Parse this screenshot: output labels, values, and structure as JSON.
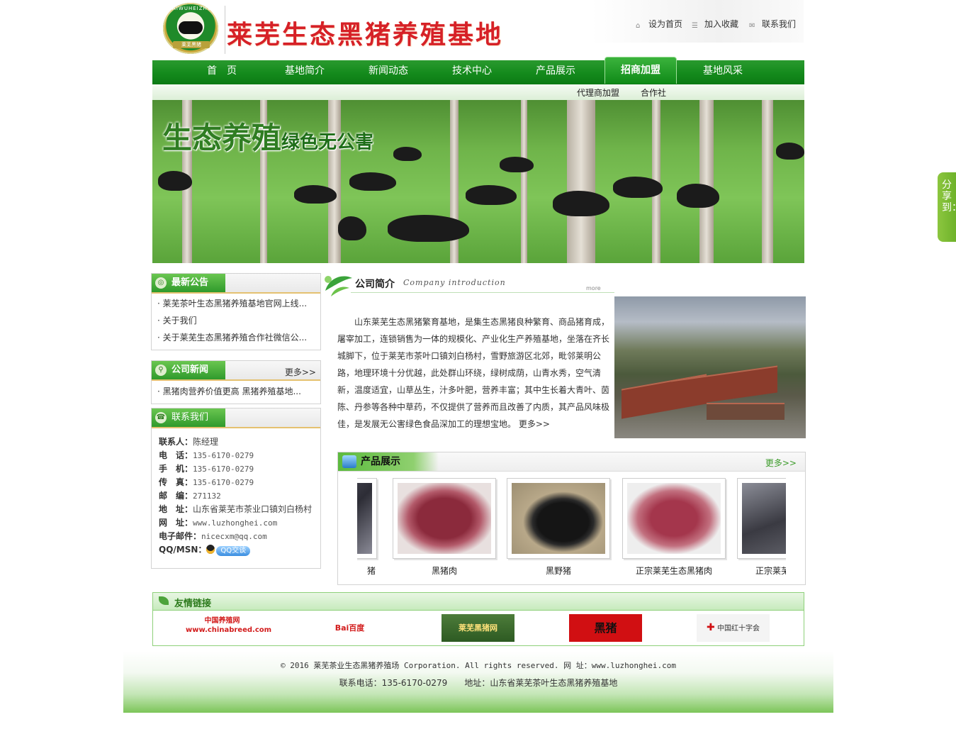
{
  "header": {
    "logo_arc_text": "LAIWUHEIZHU",
    "logo_sub_text": "莱芜黑猪",
    "site_title": "莱芜生态黑猪养殖基地",
    "links": [
      "设为首页",
      "加入收藏",
      "联系我们"
    ]
  },
  "nav": {
    "items": [
      "首　页",
      "基地简介",
      "新闻动态",
      "技术中心",
      "产品展示",
      "招商加盟",
      "基地风采"
    ],
    "active_index": 5,
    "subitems": [
      "代理商加盟",
      "合作社"
    ]
  },
  "banner": {
    "headline": "生态养殖",
    "tagline": "绿色无公害"
  },
  "notice": {
    "title": "最新公告",
    "items": [
      "· 莱芜茶叶生态黑猪养殖基地官网上线...",
      "· 关于我们",
      "· 关于莱芜生态黑猪养殖合作社微信公..."
    ]
  },
  "news": {
    "title": "公司新闻",
    "more": "更多>>",
    "items": [
      "· 黑猪肉营养价值更高 黑猪养殖基地..."
    ]
  },
  "contact": {
    "title": "联系我们",
    "rows": [
      {
        "label": "联系人：",
        "value": "陈经理"
      },
      {
        "label": "电　话：",
        "value": "135-6170-0279"
      },
      {
        "label": "手　机：",
        "value": "135-6170-0279"
      },
      {
        "label": "传　真：",
        "value": "135-6170-0279"
      },
      {
        "label": "邮　编：",
        "value": "271132"
      },
      {
        "label": "地　址：",
        "value": "山东省莱芜市茶业口镇刘白杨村"
      },
      {
        "label": "网　址：",
        "value": "www.luzhonghei.com"
      },
      {
        "label": "电子邮件：",
        "value": "nicecxm@qq.com"
      },
      {
        "label": "QQ/MSN：",
        "value": "QQ交谈"
      }
    ]
  },
  "intro": {
    "title": "公司简介",
    "title_en": "Company introduction",
    "more_small": "more",
    "text": "山东莱芜生态黑猪繁育基地，是集生态黑猪良种繁育、商品猪育成，屠宰加工，连锁销售为一体的规模化、产业化生产养殖基地，坐落在齐长城脚下，位于莱芜市茶叶口镇刘白杨村，雪野旅游区北郊，毗邻莱明公路，地理环境十分优越，此处群山环绕，绿树成荫，山青水秀，空气清新，温度适宜，山草丛生，汁多叶肥，营养丰富；其中生长着大青叶、茵陈、丹参等各种中草药，不仅提供了营养而且改善了内质，其产品风味极佳，是发展无公害绿色食品深加工的理想宝地。",
    "more": "更多>>"
  },
  "products": {
    "title": "产品展示",
    "more": "更多>>",
    "items": [
      "猪",
      "黑猪肉",
      "黑野猪",
      "正宗莱芜生态黑猪肉",
      "正宗莱芜"
    ]
  },
  "links": {
    "title": "友情链接",
    "items": [
      "中国养殖网 www.chinabreed.com",
      "Bai百度",
      "莱芜黑猪网",
      "黑猪",
      "中国红十字会"
    ]
  },
  "footer": {
    "line1": "©  2016 莱芜茶业生态黑猪养殖场 Corporation. All rights reserved. 网 址：www.luzhonghei.com",
    "line2": "联系电话：135-6170-0279　　地址：山东省莱芜茶叶生态黑猪养殖基地"
  },
  "share": {
    "label": "分享到："
  }
}
